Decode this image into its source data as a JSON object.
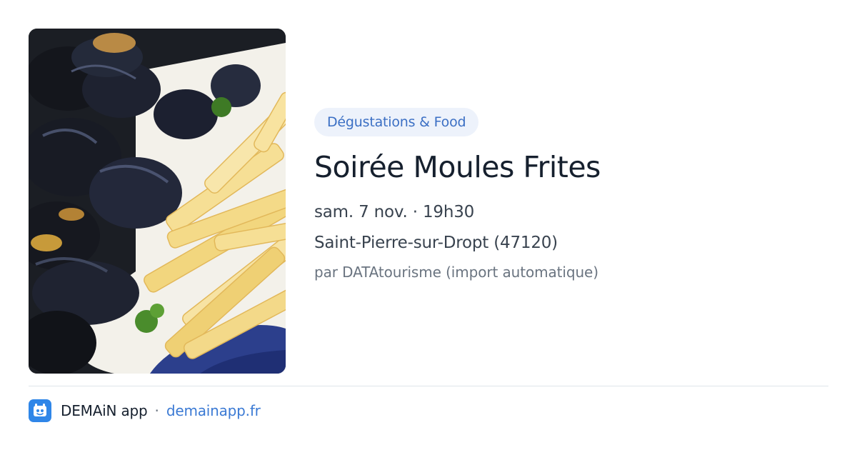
{
  "image": {
    "alt": "Moules frites"
  },
  "event": {
    "category": "Dégustations & Food",
    "title": "Soirée Moules Frites",
    "datetime": "sam. 7 nov. · 19h30",
    "location": "Saint-Pierre-sur-Dropt (47120)",
    "source": "par DATAtourisme (import automatique)"
  },
  "footer": {
    "app_icon": "app-logo-icon",
    "app_name": "DEMAiN app",
    "separator": "·",
    "domain": "demainapp.fr"
  },
  "colors": {
    "badge_background": "#edf2fb",
    "badge_text": "#3b6fc4",
    "title": "#16202e",
    "body_text": "#39434f",
    "muted_text": "#6a7480",
    "link": "#3b7ad4",
    "app_icon": "#2f86e8",
    "divider": "#dfe5ea"
  }
}
